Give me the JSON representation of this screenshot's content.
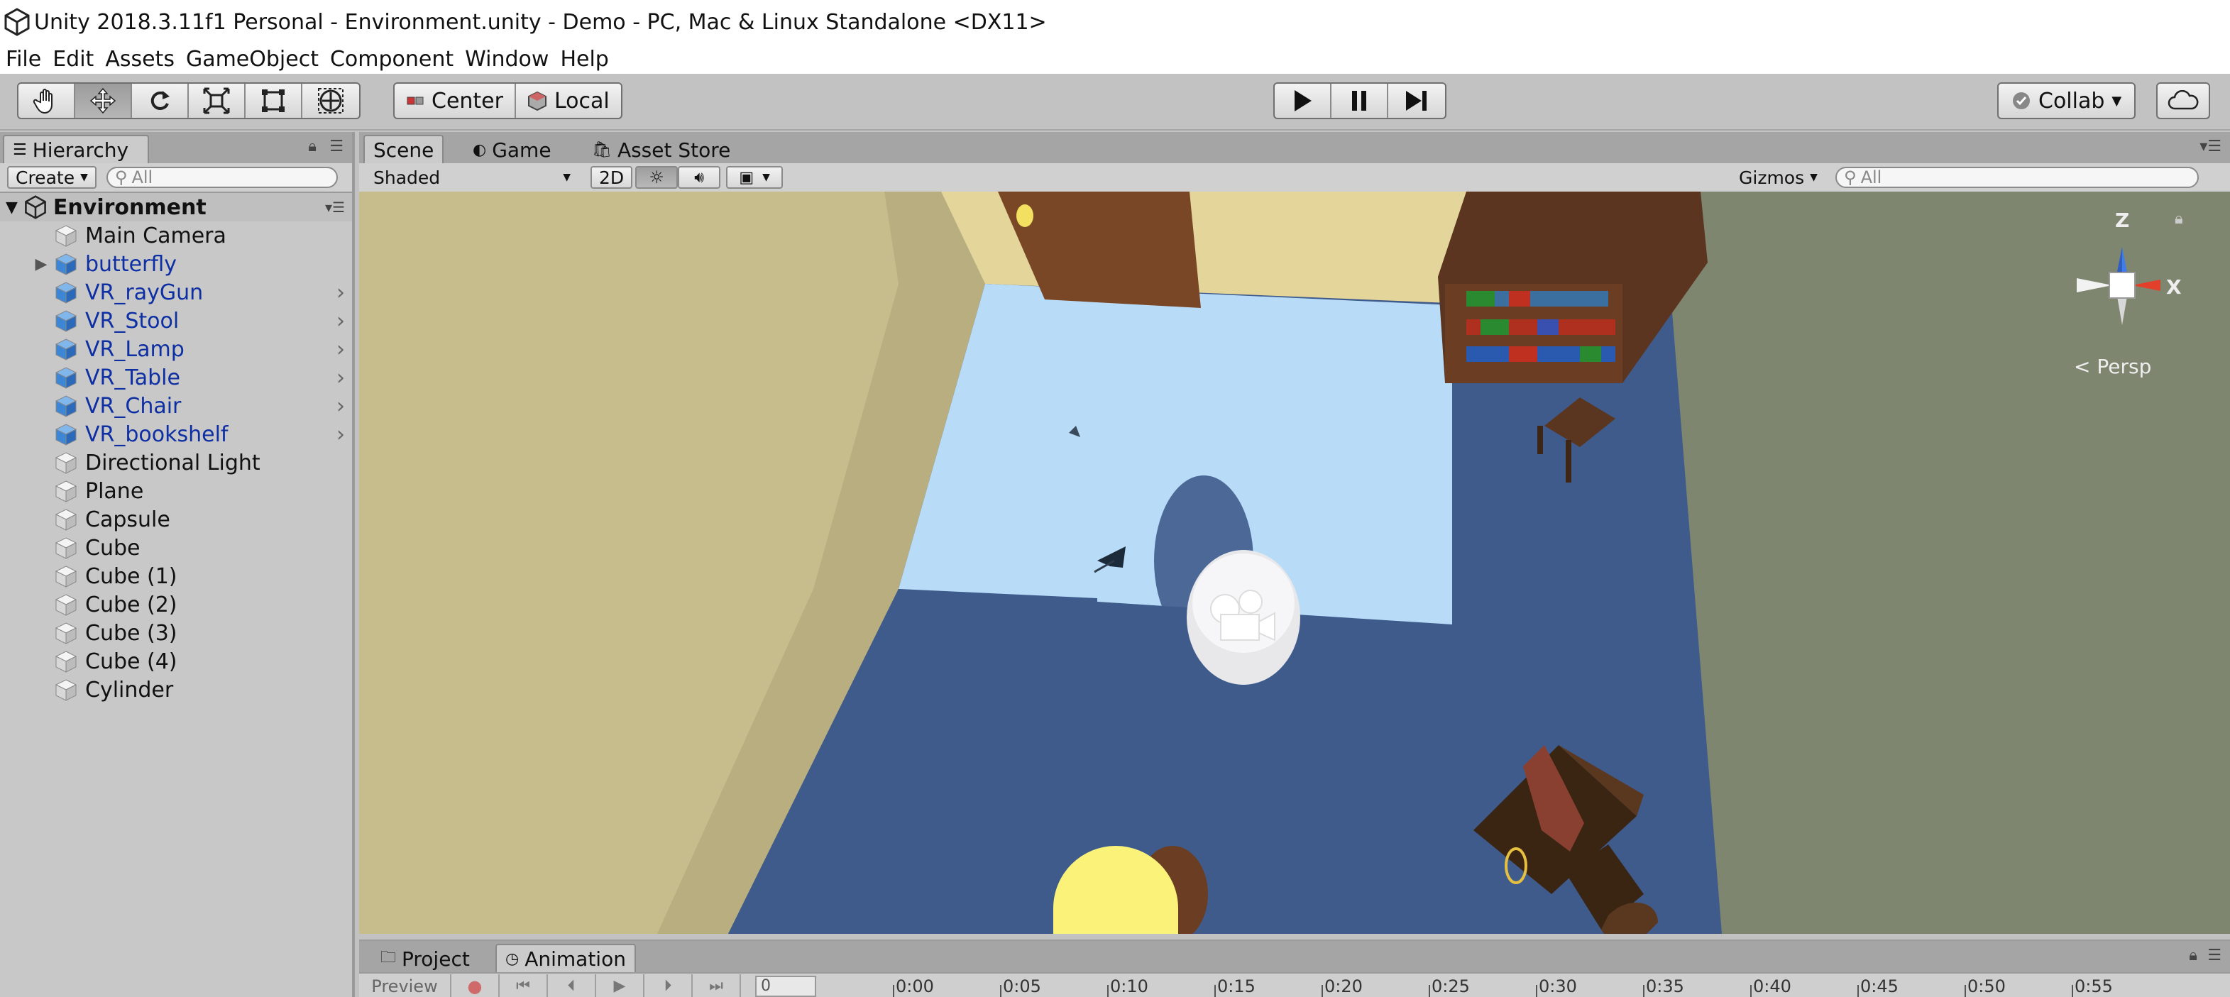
{
  "window": {
    "title": "Unity 2018.3.11f1 Personal - Environment.unity - Demo - PC, Mac & Linux Standalone <DX11>"
  },
  "menu": [
    "File",
    "Edit",
    "Assets",
    "GameObject",
    "Component",
    "Window",
    "Help"
  ],
  "toolbar": {
    "tools": [
      {
        "name": "hand-tool",
        "icon": "hand-icon",
        "active": false
      },
      {
        "name": "move-tool",
        "icon": "move-icon",
        "active": true
      },
      {
        "name": "rotate-tool",
        "icon": "rotate-icon",
        "active": false
      },
      {
        "name": "scale-tool",
        "icon": "scale-icon",
        "active": false
      },
      {
        "name": "rect-tool",
        "icon": "rect-icon",
        "active": false
      },
      {
        "name": "transform-tool",
        "icon": "transform-icon",
        "active": false
      }
    ],
    "pivot_label": "Center",
    "space_label": "Local",
    "collab_label": "Collab"
  },
  "hierarchy": {
    "tab_label": "Hierarchy",
    "create_label": "Create",
    "search_placeholder": "All",
    "scene_name": "Environment",
    "items": [
      {
        "label": "Main Camera",
        "prefab": false,
        "expandable": false,
        "chevron": false
      },
      {
        "label": "butterfly",
        "prefab": true,
        "expandable": true,
        "chevron": false
      },
      {
        "label": "VR_rayGun",
        "prefab": true,
        "expandable": false,
        "chevron": true
      },
      {
        "label": "VR_Stool",
        "prefab": true,
        "expandable": false,
        "chevron": true
      },
      {
        "label": "VR_Lamp",
        "prefab": true,
        "expandable": false,
        "chevron": true
      },
      {
        "label": "VR_Table",
        "prefab": true,
        "expandable": false,
        "chevron": true
      },
      {
        "label": "VR_Chair",
        "prefab": true,
        "expandable": false,
        "chevron": true
      },
      {
        "label": "VR_bookshelf",
        "prefab": true,
        "expandable": false,
        "chevron": true
      },
      {
        "label": "Directional Light",
        "prefab": false,
        "expandable": false,
        "chevron": false
      },
      {
        "label": "Plane",
        "prefab": false,
        "expandable": false,
        "chevron": false
      },
      {
        "label": "Capsule",
        "prefab": false,
        "expandable": false,
        "chevron": false
      },
      {
        "label": "Cube",
        "prefab": false,
        "expandable": false,
        "chevron": false
      },
      {
        "label": "Cube (1)",
        "prefab": false,
        "expandable": false,
        "chevron": false
      },
      {
        "label": "Cube (2)",
        "prefab": false,
        "expandable": false,
        "chevron": false
      },
      {
        "label": "Cube (3)",
        "prefab": false,
        "expandable": false,
        "chevron": false
      },
      {
        "label": "Cube (4)",
        "prefab": false,
        "expandable": false,
        "chevron": false
      },
      {
        "label": "Cylinder",
        "prefab": false,
        "expandable": false,
        "chevron": false
      }
    ]
  },
  "scene": {
    "tabs": [
      {
        "label": "Scene",
        "icon": "scene-icon",
        "active": true
      },
      {
        "label": "Game",
        "icon": "game-icon",
        "active": false
      },
      {
        "label": "Asset Store",
        "icon": "store-icon",
        "active": false
      }
    ],
    "draw_mode": "Shaded",
    "mode_2d": "2D",
    "gizmos_label": "Gizmos",
    "search_placeholder": "All",
    "gizmo": {
      "axis_z": "Z",
      "axis_x": "X",
      "projection": "Persp"
    }
  },
  "bottom": {
    "tabs": [
      {
        "label": "Project",
        "icon": "folder-icon",
        "active": false
      },
      {
        "label": "Animation",
        "icon": "clock-icon",
        "active": true
      }
    ],
    "preview_label": "Preview",
    "frame_value": "0",
    "timeline_ticks": [
      "0:00",
      "0:05",
      "0:10",
      "0:15",
      "0:20",
      "0:25",
      "0:30",
      "0:35",
      "0:40",
      "0:45",
      "0:50",
      "0:55"
    ]
  }
}
